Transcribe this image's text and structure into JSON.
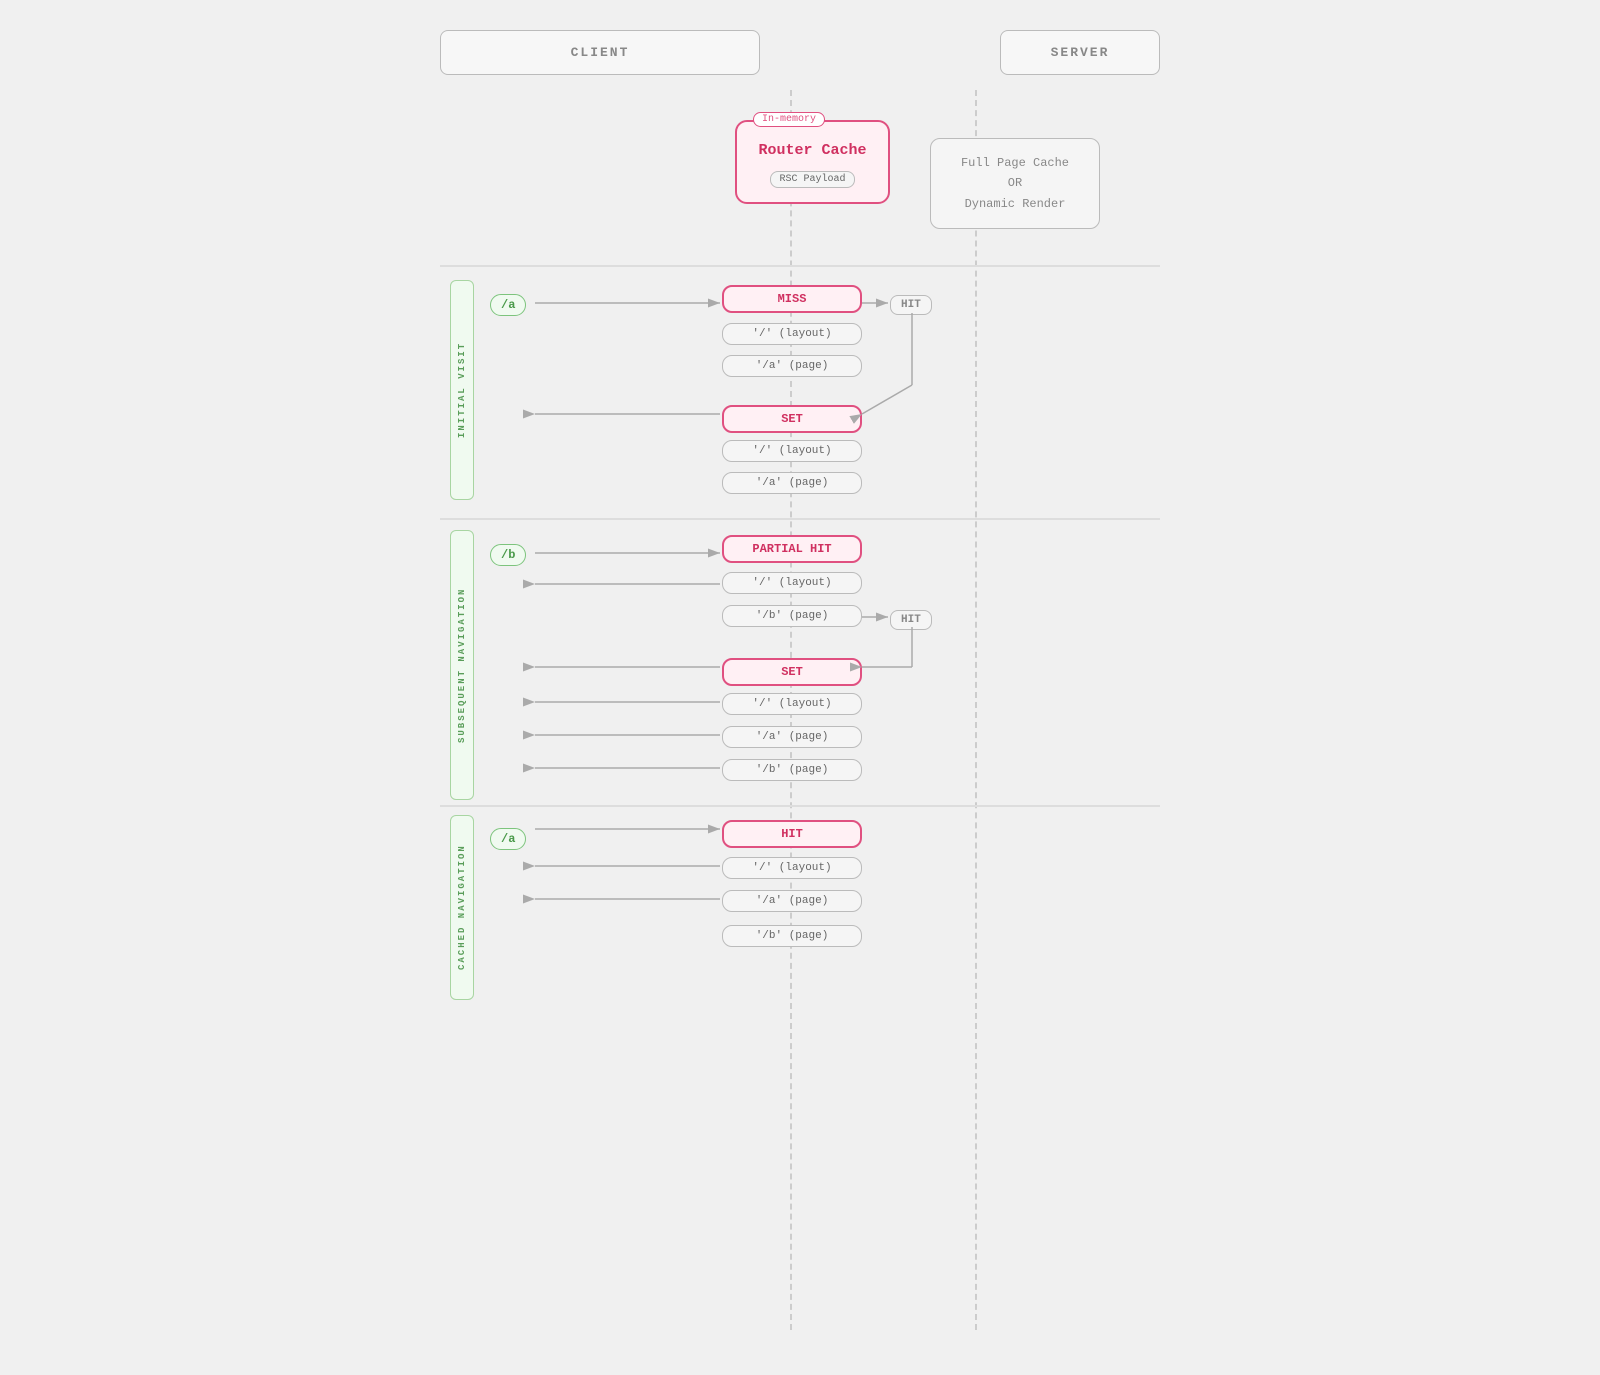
{
  "header": {
    "client_label": "CLIENT",
    "server_label": "SERVER"
  },
  "router_cache": {
    "badge_inmemory": "In-memory",
    "title": "Router Cache",
    "badge_rsc": "RSC Payload"
  },
  "server_box": {
    "line1": "Full Page Cache",
    "line2": "OR",
    "line3": "Dynamic Render"
  },
  "sections": [
    {
      "id": "initial_visit",
      "label": "INITIAL VISIT",
      "route": "/a",
      "events": [
        {
          "type": "status",
          "text": "MISS"
        },
        {
          "type": "gray",
          "text": "'/' (layout)"
        },
        {
          "type": "gray",
          "text": "'/a' (page)"
        },
        {
          "type": "hit_server",
          "text": "HIT"
        },
        {
          "type": "status",
          "text": "SET"
        },
        {
          "type": "gray",
          "text": "'/' (layout)"
        },
        {
          "type": "gray",
          "text": "'/a' (page)"
        }
      ]
    },
    {
      "id": "subsequent_nav",
      "label": "SUBSEQUENT NAVIGATION",
      "route": "/b",
      "events": [
        {
          "type": "status",
          "text": "PARTIAL HIT"
        },
        {
          "type": "gray_return",
          "text": "'/' (layout)"
        },
        {
          "type": "gray",
          "text": "'/b' (page)"
        },
        {
          "type": "hit_server",
          "text": "HIT"
        },
        {
          "type": "status",
          "text": "SET"
        },
        {
          "type": "gray_return",
          "text": "'/' (layout)"
        },
        {
          "type": "gray_return",
          "text": "'/a' (page)"
        },
        {
          "type": "gray_return",
          "text": "'/b' (page)"
        }
      ]
    },
    {
      "id": "cached_nav",
      "label": "CACHED NAVIGATION",
      "route": "/a",
      "events": [
        {
          "type": "status",
          "text": "HIT"
        },
        {
          "type": "gray_return",
          "text": "'/' (layout)"
        },
        {
          "type": "gray_return",
          "text": "'/a' (page)"
        },
        {
          "type": "gray_nostroke",
          "text": "'/b' (page)"
        }
      ]
    }
  ],
  "colors": {
    "pink_border": "#e05080",
    "pink_bg": "#fff0f4",
    "pink_text": "#d03060",
    "green_border": "#7dc47d",
    "green_bg": "#f0faf0",
    "green_text": "#4a9a4a",
    "gray_border": "#bbb",
    "gray_bg": "#f5f5f5",
    "gray_text": "#888",
    "dashed_line": "#ccc"
  }
}
